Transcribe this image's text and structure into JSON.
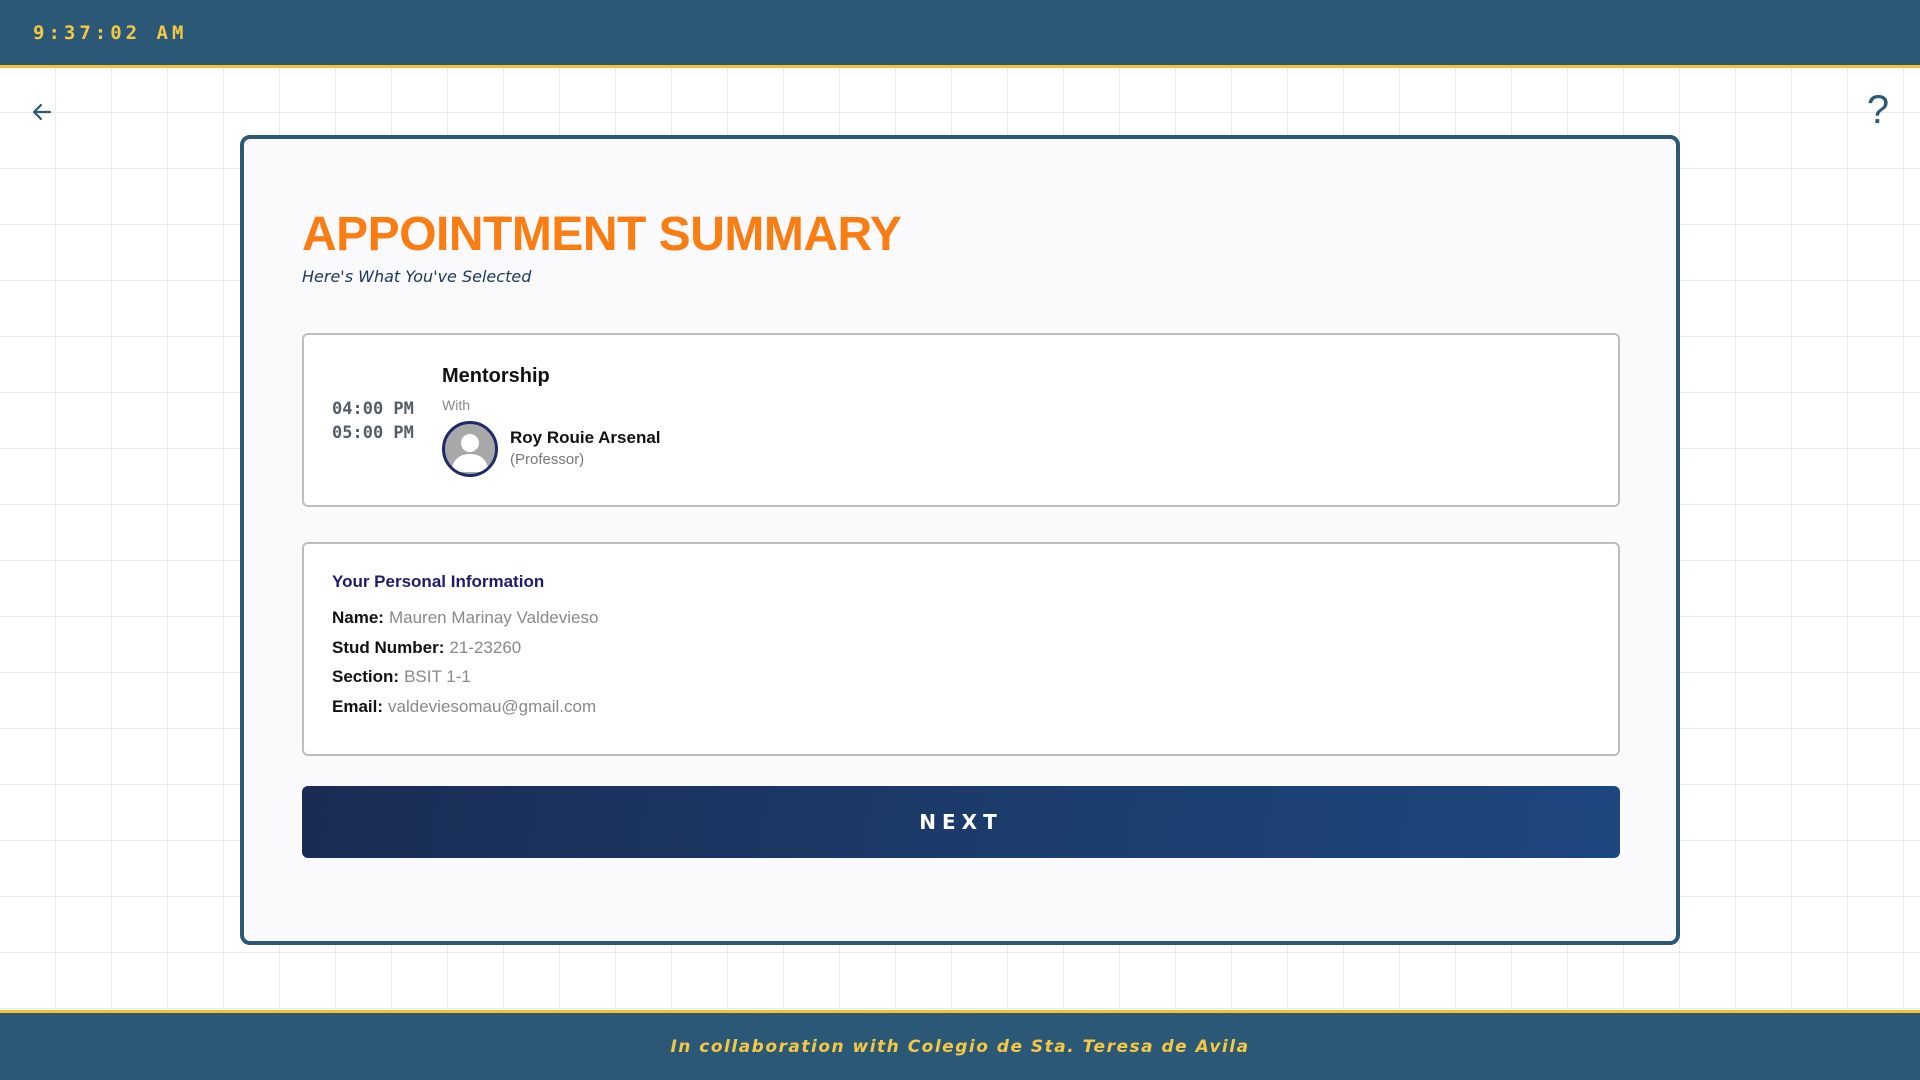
{
  "header": {
    "clock": "9:37:02 AM",
    "colors": {
      "bar": "#2c5878",
      "accent": "#f5c842"
    }
  },
  "nav": {
    "back_icon": "arrow-left-icon",
    "help_label": "?"
  },
  "summary": {
    "title": "APPOINTMENT SUMMARY",
    "subtitle": "Here's What You've Selected",
    "title_color": "#fa7d14"
  },
  "appointment": {
    "start_time": "04:00 PM",
    "end_time": "05:00 PM",
    "service": "Mentorship",
    "with_label": "With",
    "avatar_icon": "user-avatar-icon",
    "professor_name": "Roy Rouie Arsenal",
    "professor_role": "(Professor)"
  },
  "personal_info": {
    "heading": "Your Personal Information",
    "fields": [
      {
        "label": "Name:",
        "value": "Mauren Marinay Valdevieso"
      },
      {
        "label": "Stud Number:",
        "value": "21-23260"
      },
      {
        "label": "Section:",
        "value": "BSIT 1-1"
      },
      {
        "label": "Email:",
        "value": "valdeviesomau@gmail.com"
      }
    ]
  },
  "actions": {
    "next_label": "NEXT"
  },
  "footer": {
    "text": "In collaboration with Colegio de Sta. Teresa de Avila"
  }
}
